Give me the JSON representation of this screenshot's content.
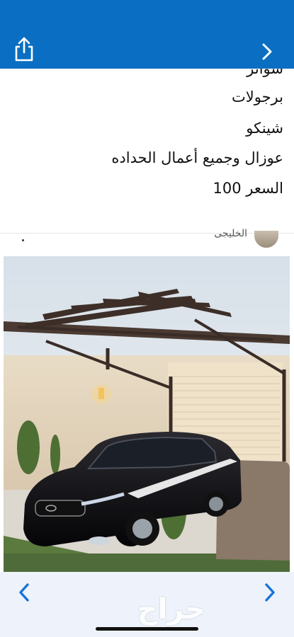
{
  "topbar": {
    "background": "#0a6fc2",
    "share_icon": "share-icon",
    "back_icon": "chevron-right-icon"
  },
  "description": {
    "lines": [
      "سواتر",
      "برجولات",
      "شينكو",
      "عوزال وجميع أعمال الحداده",
      "السعر 100"
    ]
  },
  "post": {
    "username": "الخليجي",
    "photo_description": ""
  },
  "bottom_nav": {
    "prev_icon": "chevron-left-icon",
    "next_icon": "chevron-right-icon",
    "watermark": "حراج",
    "accent": "#1a73d9"
  }
}
